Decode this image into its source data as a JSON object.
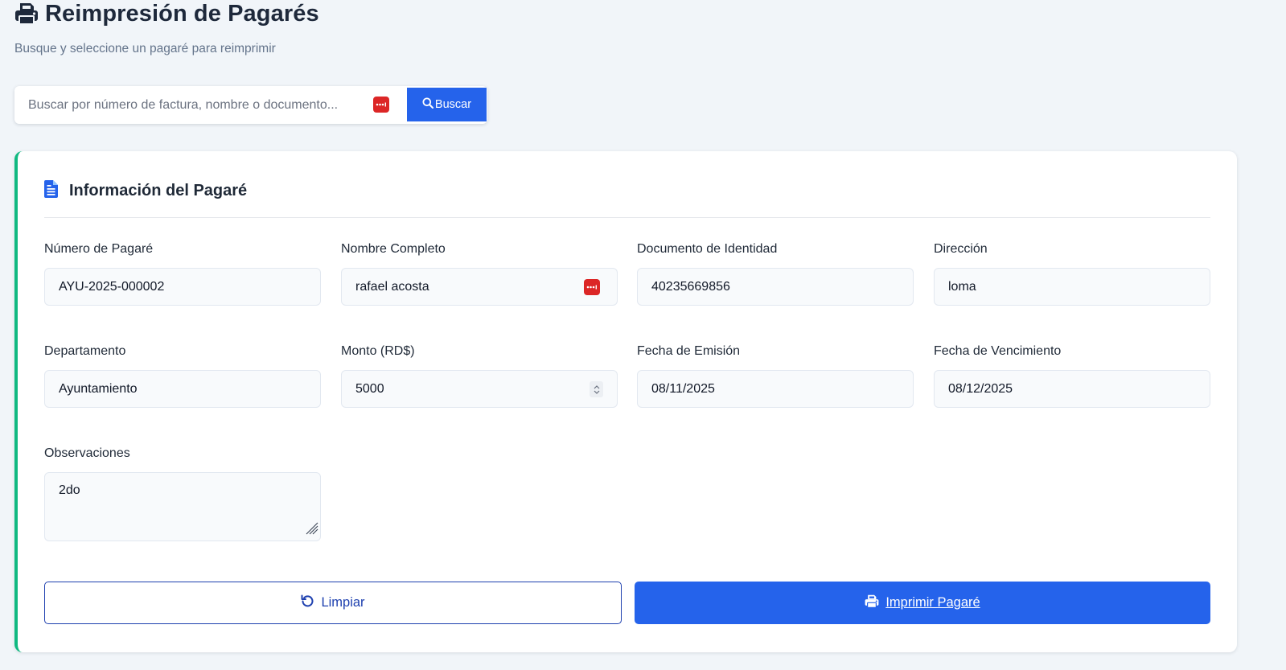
{
  "header": {
    "title": "Reimpresión de Pagarés",
    "subtitle": "Busque y seleccione un pagaré para reimprimir",
    "title_icon": "printer-icon"
  },
  "search": {
    "placeholder": "Buscar por número de factura, nombre o documento...",
    "value": "",
    "button_label": "Buscar",
    "button_icon": "search-icon"
  },
  "card": {
    "title": "Información del Pagaré",
    "title_icon": "document-icon",
    "accent_color": "#10b981"
  },
  "fields": {
    "numero": {
      "label": "Número de Pagaré",
      "value": "AYU-2025-000002"
    },
    "nombre": {
      "label": "Nombre Completo",
      "value": "rafael acosta"
    },
    "documento": {
      "label": "Documento de Identidad",
      "value": "40235669856"
    },
    "direccion": {
      "label": "Dirección",
      "value": "loma"
    },
    "departamento": {
      "label": "Departamento",
      "value": "Ayuntamiento"
    },
    "monto": {
      "label": "Monto (RD$)",
      "value": "5000"
    },
    "emision": {
      "label": "Fecha de Emisión",
      "value": "08/11/2025"
    },
    "vencimiento": {
      "label": "Fecha de Vencimiento",
      "value": "08/12/2025"
    },
    "observaciones": {
      "label": "Observaciones",
      "value": "2do"
    }
  },
  "actions": {
    "clear_label": "Limpiar",
    "clear_icon": "undo-icon",
    "print_label": "Imprimir Pagaré",
    "print_icon": "printer-icon"
  },
  "colors": {
    "primary": "#2563eb",
    "outline": "#1e40af",
    "password_badge": "#dc2626",
    "background": "#f1f5f9"
  }
}
